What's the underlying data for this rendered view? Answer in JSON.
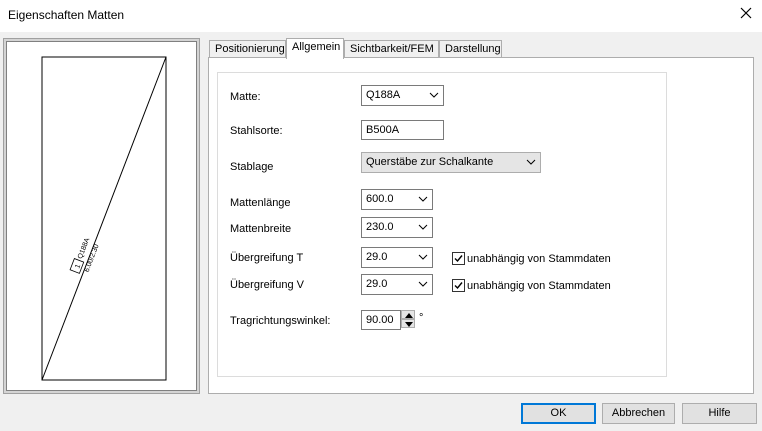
{
  "window": {
    "title": "Eigenschaften Matten"
  },
  "preview": {
    "mat_label": "Q188A",
    "dimension_label": "6.00/2.30",
    "box_number": "1"
  },
  "tabs": [
    {
      "label": "Positionierung"
    },
    {
      "label": "Allgemein"
    },
    {
      "label": "Sichtbarkeit/FEM"
    },
    {
      "label": "Darstellung"
    }
  ],
  "form": {
    "matte_label": "Matte:",
    "matte_value": "Q188A",
    "stahlsorte_label": "Stahlsorte:",
    "stahlsorte_value": "B500A",
    "stablage_label": "Stablage",
    "stablage_value": "Querstäbe zur Schalkante",
    "mattenlaenge_label": "Mattenlänge",
    "mattenlaenge_value": "600.0",
    "mattenbreite_label": "Mattenbreite",
    "mattenbreite_value": "230.0",
    "uebergreifung_t_label": "Übergreifung T",
    "uebergreifung_t_value": "29.0",
    "uebergreifung_t_check_label": "unabhängig von Stammdaten",
    "uebergreifung_v_label": "Übergreifung V",
    "uebergreifung_v_value": "29.0",
    "uebergreifung_v_check_label": "unabhängig von Stammdaten",
    "tragrichtung_label": "Tragrichtungswinkel:",
    "tragrichtung_value": "90.00",
    "tragrichtung_unit": "°"
  },
  "buttons": {
    "ok": "OK",
    "cancel": "Abbrechen",
    "help": "Hilfe"
  }
}
